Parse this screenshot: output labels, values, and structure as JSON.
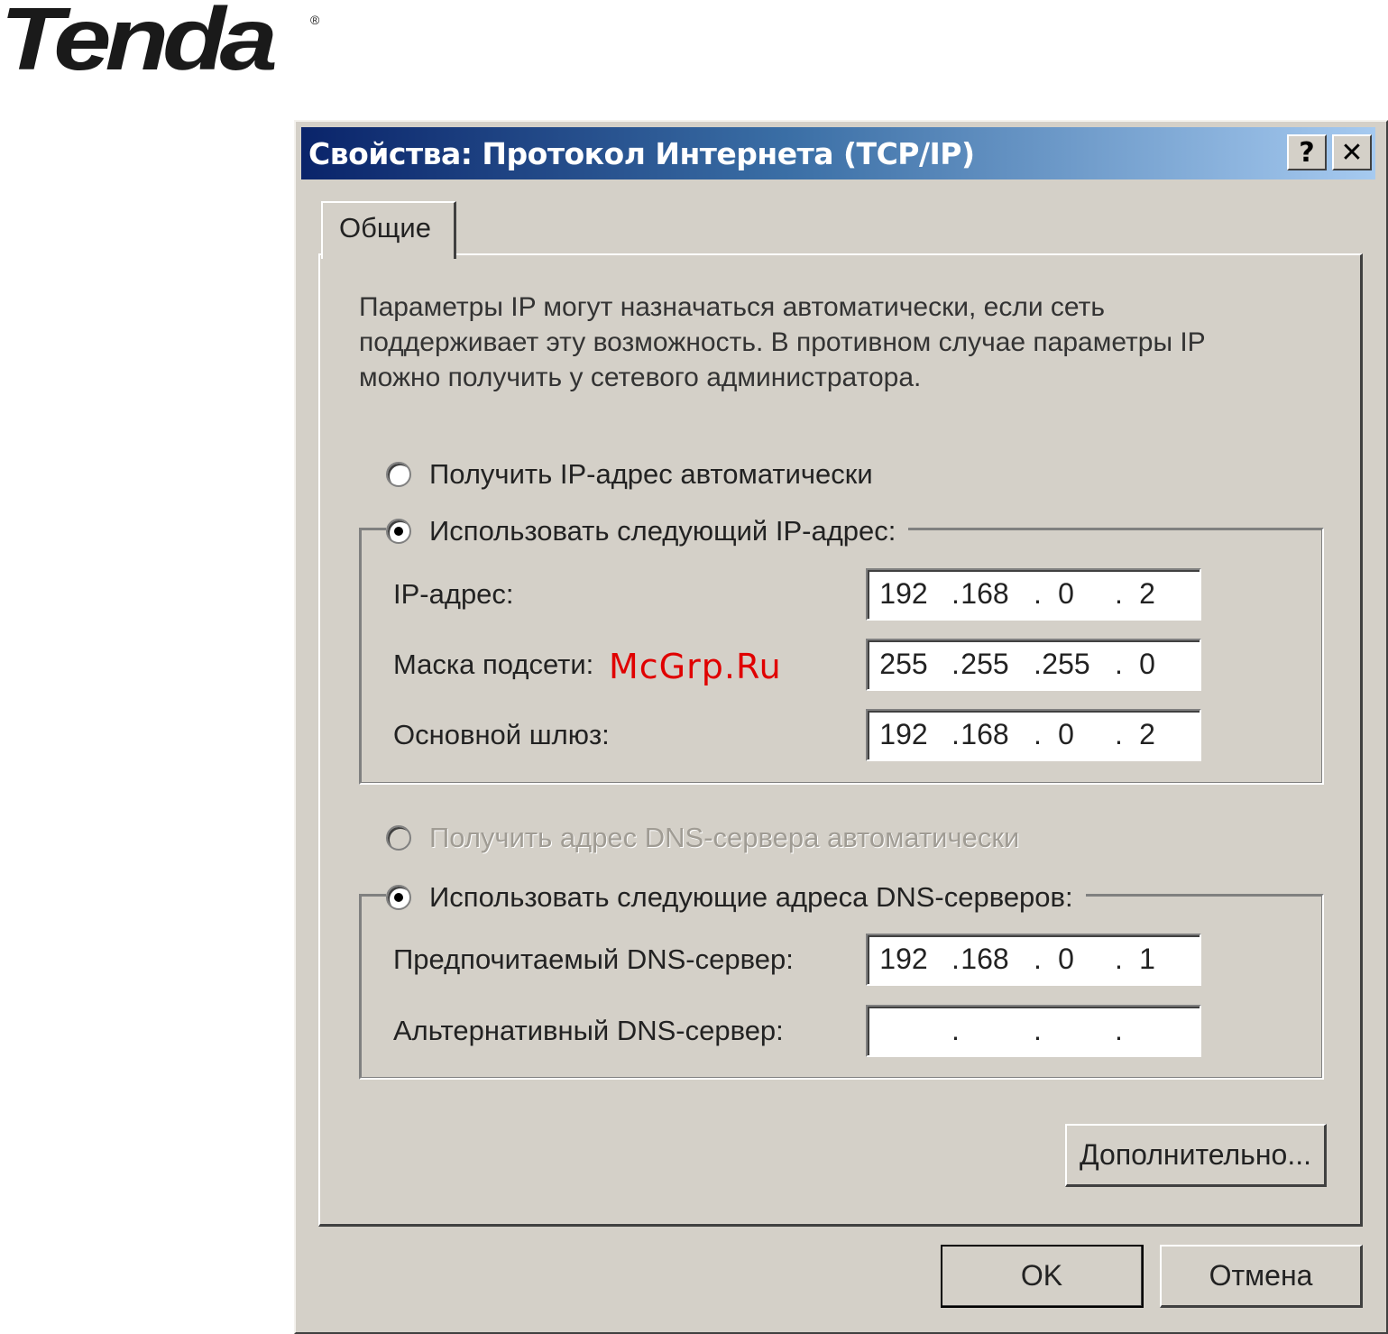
{
  "brand": {
    "logo": "Tenda",
    "registered_mark": "®"
  },
  "dialog": {
    "title": "Свойства: Протокол Интернета (TCP/IP)",
    "help_label": "?",
    "close_label": "✕",
    "tab_label": "Общие",
    "description": "Параметры IP могут назначаться автоматически, если сеть поддерживает эту возможность. В противном случае параметры IP можно получить у сетевого администратора.",
    "ip_mode": {
      "auto_label": "Получить IP-адрес автоматически",
      "manual_label": "Использовать следующий IP-адрес:",
      "selected": "manual"
    },
    "ip_fields": {
      "ip_address_label": "IP-адрес:",
      "ip_address": [
        "192",
        "168",
        "0",
        "2"
      ],
      "subnet_label": "Маска подсети:",
      "subnet": [
        "255",
        "255",
        "255",
        "0"
      ],
      "gateway_label": "Основной шлюз:",
      "gateway": [
        "192",
        "168",
        "0",
        "2"
      ]
    },
    "dns_mode": {
      "auto_label": "Получить адрес DNS-сервера автоматически",
      "auto_disabled": true,
      "manual_label": "Использовать следующие адреса DNS-серверов:",
      "selected": "manual"
    },
    "dns_fields": {
      "preferred_label": "Предпочитаемый DNS-сервер:",
      "preferred": [
        "192",
        "168",
        "0",
        "1"
      ],
      "alternate_label": "Альтернативный DNS-сервер:",
      "alternate": [
        "",
        "",
        "",
        ""
      ]
    },
    "buttons": {
      "advanced": "Дополнительно...",
      "ok": "OK",
      "cancel": "Отмена"
    }
  },
  "watermark": "McGrp.Ru",
  "colors": {
    "dialog_bg": "#d4d0c8",
    "title_start": "#0a246a",
    "title_end": "#a6caf0",
    "watermark": "#e00000"
  }
}
